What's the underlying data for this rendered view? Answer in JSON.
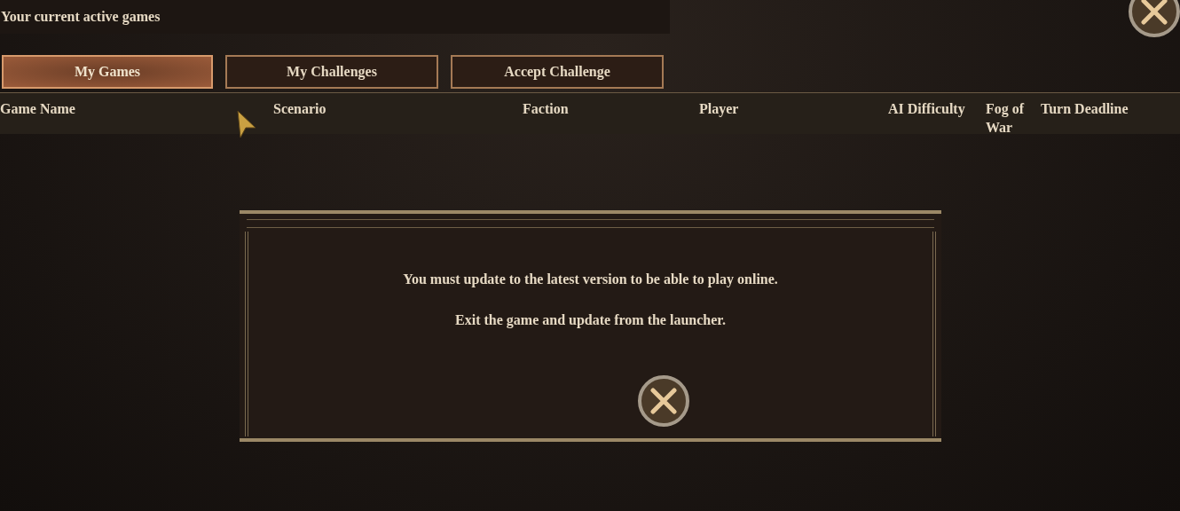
{
  "header": {
    "title": "Your current active games"
  },
  "tabs": [
    {
      "label": "My Games",
      "selected": true
    },
    {
      "label": "My Challenges",
      "selected": false
    },
    {
      "label": "Accept Challenge",
      "selected": false
    }
  ],
  "table": {
    "columns": [
      "Game Name",
      "Scenario",
      "Faction",
      "Player",
      "AI Difficulty",
      "Fog of War",
      "Turn Deadline"
    ]
  },
  "dialog": {
    "messages": [
      "You must update to the latest version to be able to play online.",
      "Exit the game and update from the launcher."
    ]
  }
}
